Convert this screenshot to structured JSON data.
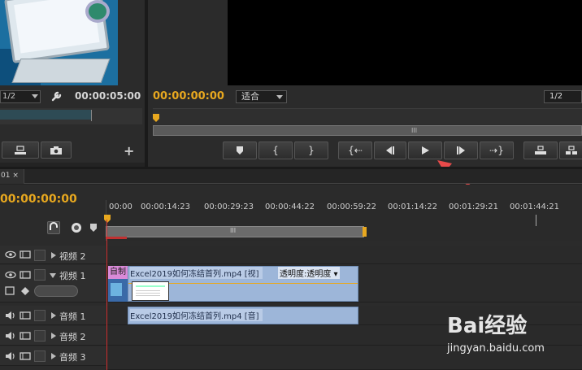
{
  "source_monitor": {
    "scale_value": "1/2",
    "timecode": "00:00:05:00",
    "add_symbol": "+"
  },
  "program_monitor": {
    "timecode": "00:00:00:00",
    "fit_value": "适合",
    "resolution_value": "1/2",
    "grip": "III"
  },
  "timeline": {
    "tab_label": "01 ×",
    "timecode": "00:00:00:00",
    "ruler_ticks": [
      "00:00",
      "00:00:14:23",
      "00:00:29:23",
      "00:00:44:22",
      "00:00:59:22",
      "00:01:14:22",
      "00:01:29:21",
      "00:01:44:21"
    ],
    "grip": "III",
    "tracks": {
      "video2": "视频 2",
      "video1": "视频 1",
      "audio1": "音频 1",
      "audio2": "音频 2",
      "audio3": "音频 3"
    },
    "clips": {
      "title_clip": "自制",
      "video_clip": "Excel2019如何冻结首列.mp4 [视]",
      "opacity_label": "透明度:透明度 ▾",
      "audio_clip": "Excel2019如何冻结首列.mp4 [音]"
    }
  },
  "watermark": {
    "logo": "Bai经验",
    "url": "jingyan.baidu.com"
  },
  "colors": {
    "timecode_accent": "#e8a81f",
    "clip_video": "#9db6d9",
    "clip_title": "#d98ad8",
    "arrow_annotation": "#e84a4a"
  }
}
